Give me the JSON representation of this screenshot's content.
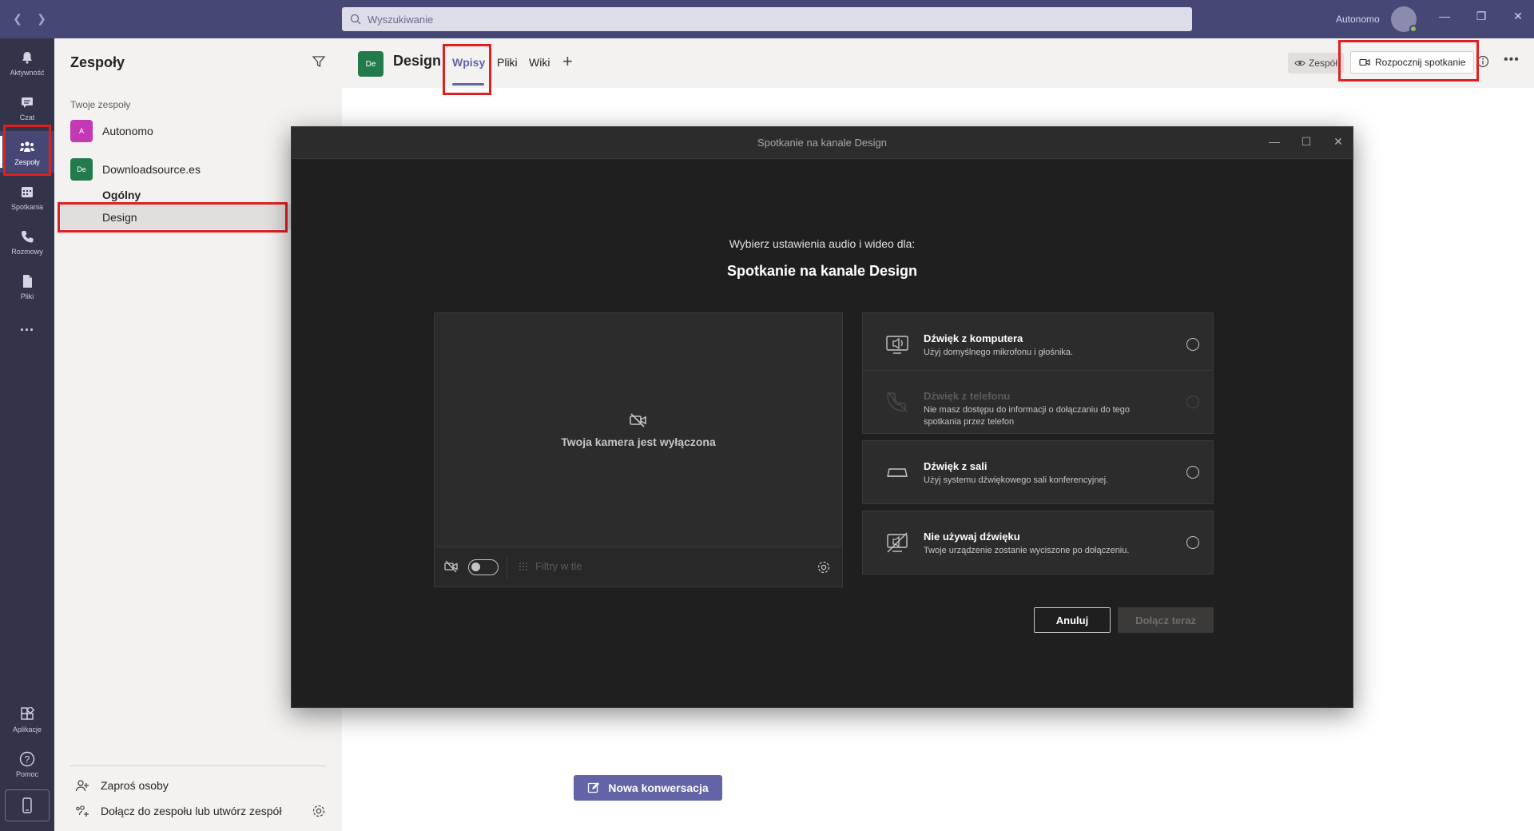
{
  "topbar": {
    "search_placeholder": "Wyszukiwanie",
    "user_name": "Autonomo"
  },
  "rail": {
    "items": [
      {
        "label": "Aktywność",
        "icon": "bell-icon"
      },
      {
        "label": "Czat",
        "icon": "chat-icon"
      },
      {
        "label": "Zespoły",
        "icon": "teams-icon",
        "active": true
      },
      {
        "label": "Spotkania",
        "icon": "calendar-icon"
      },
      {
        "label": "Rozmowy",
        "icon": "phone-icon"
      },
      {
        "label": "Pliki",
        "icon": "file-icon"
      }
    ],
    "more": "...",
    "apps_label": "Aplikacje",
    "help_label": "Pomoc"
  },
  "teams": {
    "title": "Zespoły",
    "section_label": "Twoje zespoły",
    "list": [
      {
        "avatar": "A",
        "name": "Autonomo",
        "color": "#c239b3"
      },
      {
        "avatar": "De",
        "name": "Downloadsource.es",
        "color": "#237b4b"
      }
    ],
    "channels": [
      "Ogólny",
      "Design"
    ],
    "invite_label": "Zaproś osoby",
    "join_label": "Dołącz do zespołu lub utwórz zespół"
  },
  "channel_header": {
    "avatar": "De",
    "title": "Design",
    "tabs": [
      "Wpisy",
      "Pliki",
      "Wiki"
    ],
    "team_chip": "Zespół",
    "meet_button": "Rozpocznij spotkanie"
  },
  "main": {
    "new_conversation": "Nowa konwersacja"
  },
  "modal": {
    "title": "Spotkanie na kanale Design",
    "subtitle": "Wybierz ustawienia audio i wideo dla:",
    "heading": "Spotkanie na kanale Design",
    "camera_off": "Twoja kamera jest wyłączona",
    "filters": "Filtry w tle",
    "audio_options": [
      {
        "title": "Dźwięk z komputera",
        "desc": "Użyj domyślnego mikrofonu i głośnika.",
        "icon": "computer-audio-icon",
        "disabled": false
      },
      {
        "title": "Dźwięk z telefonu",
        "desc": "Nie masz dostępu do informacji o dołączaniu do tego spotkania przez telefon",
        "icon": "phone-audio-icon",
        "disabled": true
      },
      {
        "title": "Dźwięk z sali",
        "desc": "Użyj systemu dźwiękowego sali konferencyjnej.",
        "icon": "room-audio-icon",
        "disabled": false
      },
      {
        "title": "Nie używaj dźwięku",
        "desc": "Twoje urządzenie zostanie wyciszone po dołączeniu.",
        "icon": "no-audio-icon",
        "disabled": false
      }
    ],
    "cancel": "Anuluj",
    "join": "Dołącz teraz"
  },
  "colors": {
    "brand": "#6264a7",
    "titlebar": "#464775",
    "rail": "#33344a",
    "highlight": "#e02020"
  }
}
